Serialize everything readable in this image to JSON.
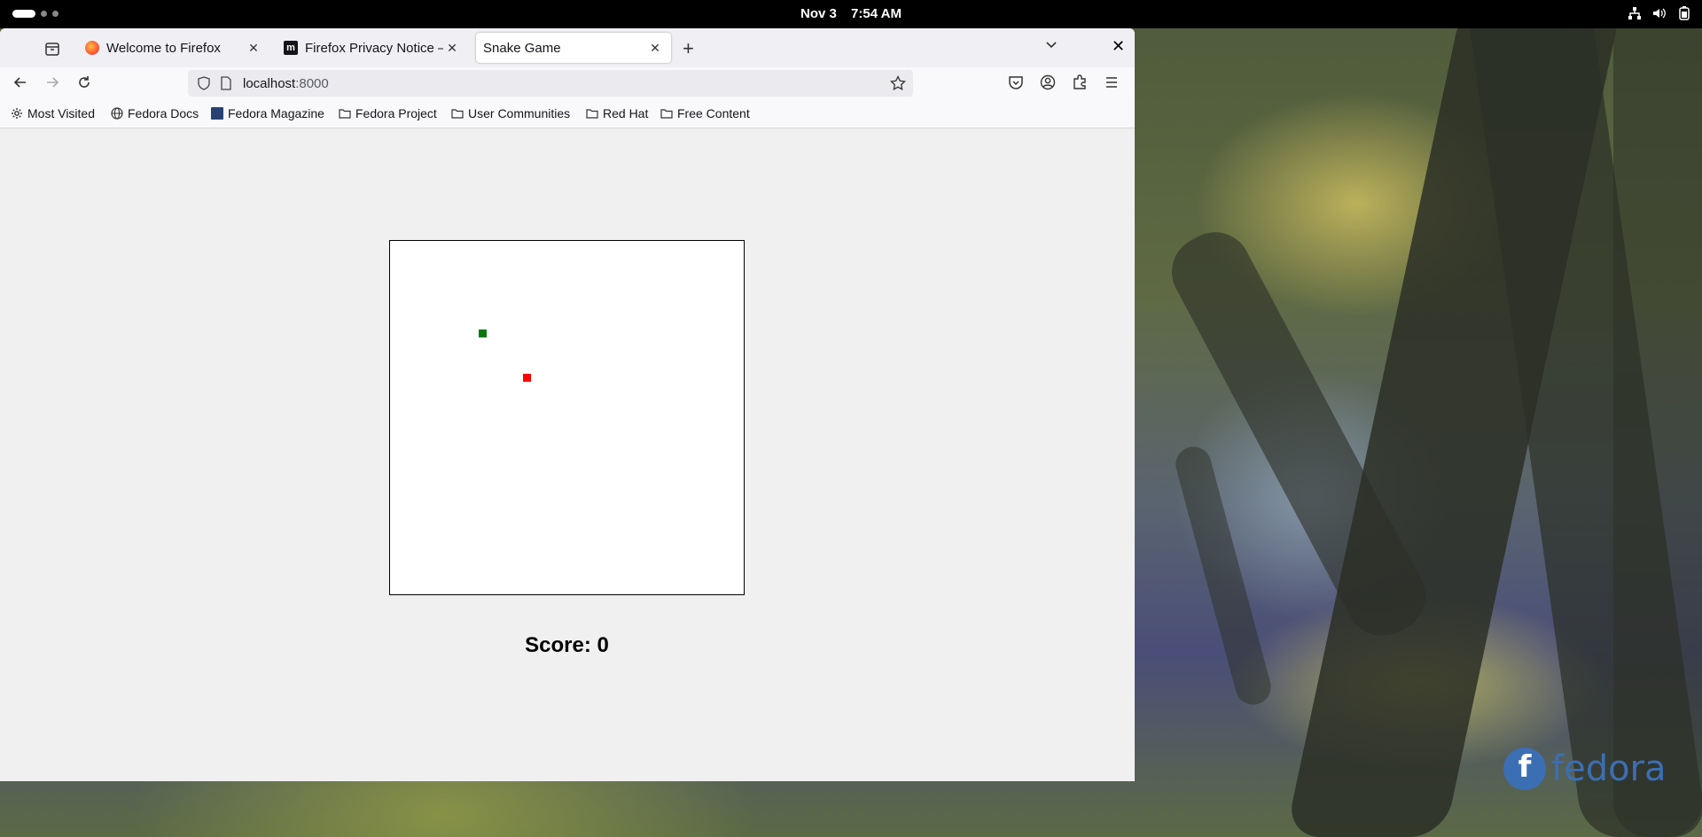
{
  "topbar": {
    "date": "Nov 3",
    "time": "7:54 AM"
  },
  "tabs": [
    {
      "title": "Welcome to Firefox",
      "active": false
    },
    {
      "title": "Firefox Privacy Notice — M",
      "active": false
    },
    {
      "title": "Snake Game",
      "active": true
    }
  ],
  "urlbar": {
    "host": "localhost",
    "port": ":8000"
  },
  "bookmarks": [
    {
      "label": "Most Visited",
      "icon": "gear-icon"
    },
    {
      "label": "Fedora Docs",
      "icon": "globe-icon"
    },
    {
      "label": "Fedora Magazine",
      "icon": "fedora-magazine-icon"
    },
    {
      "label": "Fedora Project",
      "icon": "folder-icon"
    },
    {
      "label": "User Communities",
      "icon": "folder-icon"
    },
    {
      "label": "Red Hat",
      "icon": "folder-icon"
    },
    {
      "label": "Free Content",
      "icon": "folder-icon"
    }
  ],
  "game": {
    "score_label": "Score: 0",
    "snake_color": "#0b7a0b",
    "food_color": "#ff0000"
  },
  "desktop": {
    "logo_text": "fedora"
  }
}
